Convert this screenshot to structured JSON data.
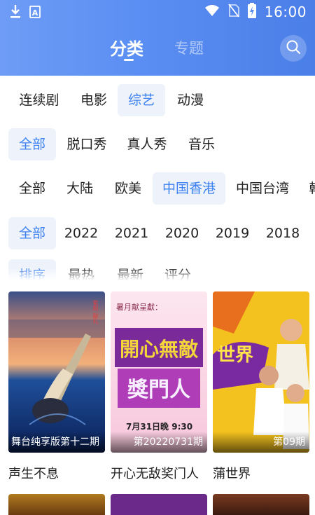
{
  "status_bar": {
    "time": "16:00",
    "icons": [
      "download-icon",
      "a-icon",
      "wifi-icon",
      "no-sim-icon",
      "battery-charging-icon"
    ]
  },
  "header": {
    "tabs": [
      {
        "label": "分类",
        "active": true
      },
      {
        "label": "专题",
        "active": false
      }
    ],
    "search_icon": "search-icon",
    "accent": "#5a8ef2"
  },
  "filters": {
    "type": [
      "连续剧",
      "电影",
      "综艺",
      "动漫"
    ],
    "type_selected": "综艺",
    "subtype": [
      "全部",
      "脱口秀",
      "真人秀",
      "音乐"
    ],
    "subtype_selected": "全部",
    "region": [
      "全部",
      "大陆",
      "欧美",
      "中国香港",
      "中国台湾",
      "韩"
    ],
    "region_selected": "中国香港",
    "year": [
      "全部",
      "2022",
      "2021",
      "2020",
      "2019",
      "2018"
    ],
    "year_selected": "全部",
    "sort": [
      "排序",
      "最热",
      "最新",
      "评分"
    ],
    "sort_selected": "排序",
    "active_color": "#3d82f0"
  },
  "videos": [
    {
      "title": "声生不息",
      "caption": "舞台纯享版第十二期",
      "poster_text": "紫荆 献礼"
    },
    {
      "title": "开心无敌奖门人",
      "caption": "第20220731期",
      "poster_text": "7月31日晚 9:30",
      "poster_top": "暑月献呈獻："
    },
    {
      "title": "蒲世界",
      "caption": "第09期",
      "poster_text": "世界"
    }
  ]
}
